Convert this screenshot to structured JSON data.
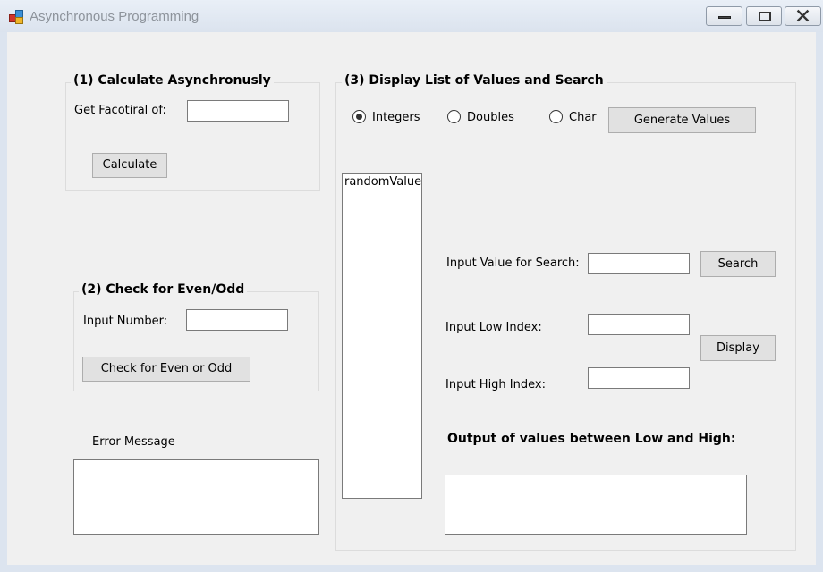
{
  "window": {
    "title": "Asynchronous Programming",
    "icon": "app-icon",
    "controls": [
      "minimize-icon",
      "maximize-icon",
      "close-icon"
    ]
  },
  "group1": {
    "title": "(1) Calculate Asynchronusly",
    "factorial_label": "Get Facotiral of:",
    "factorial_value": "",
    "calculate_label": "Calculate"
  },
  "group2": {
    "title": "(2) Check for Even/Odd",
    "number_label": "Input Number:",
    "number_value": "",
    "check_label": "Check for Even or Odd"
  },
  "error": {
    "label": "Error Message",
    "value": ""
  },
  "group3": {
    "title": "(3) Display List of Values and Search",
    "radios": [
      {
        "label": "Integers",
        "checked": true
      },
      {
        "label": "Doubles",
        "checked": false
      },
      {
        "label": "Char",
        "checked": false
      }
    ],
    "generate_label": "Generate Values",
    "list_items": [
      "randomValue"
    ],
    "search_label": "Input Value for Search:",
    "search_value": "",
    "search_button": "Search",
    "low_label": "Input Low Index:",
    "low_value": "",
    "high_label": "Input High Index:",
    "high_value": "",
    "display_button": "Display",
    "output_label": "Output of values between Low and High:",
    "output_value": ""
  }
}
